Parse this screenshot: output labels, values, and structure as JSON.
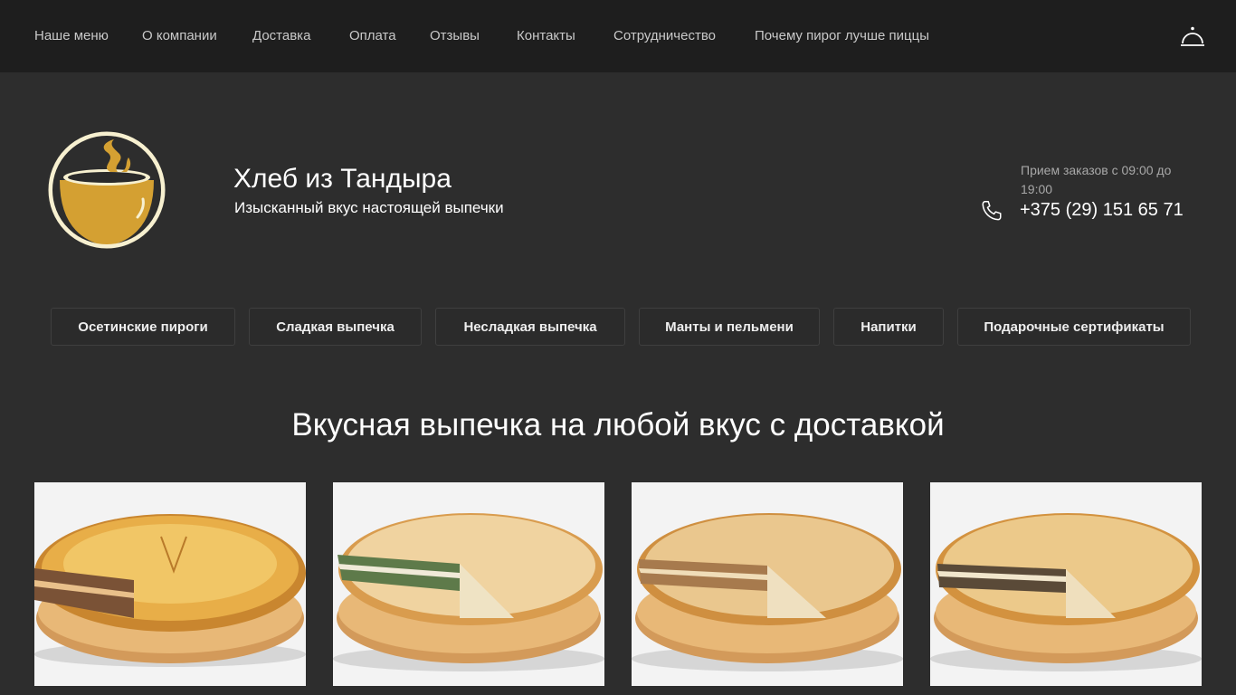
{
  "nav": {
    "items": [
      {
        "label": "Наше меню"
      },
      {
        "label": "О компании"
      },
      {
        "label": "Доставка"
      },
      {
        "label": "Оплата"
      },
      {
        "label": "Отзывы"
      },
      {
        "label": "Контакты"
      },
      {
        "label": "Сотрудничество"
      },
      {
        "label": "Почему пирог лучше пиццы"
      }
    ],
    "cart_icon": "cloche-icon"
  },
  "header": {
    "logo_icon": "pot-logo-icon",
    "title": "Хлеб из Тандыра",
    "subtitle": "Изысканный вкус настоящей выпечки",
    "hours": "Прием заказов с 09:00 до 19:00",
    "phone": "+375 (29) 151 65 71",
    "phone_icon": "phone-icon"
  },
  "categories": [
    {
      "label": "Осетинские пироги"
    },
    {
      "label": "Сладкая выпечка"
    },
    {
      "label": "Несладкая выпечка"
    },
    {
      "label": "Манты и пельмени"
    },
    {
      "label": "Напитки"
    },
    {
      "label": "Подарочные сертификаты"
    }
  ],
  "section": {
    "title": "Вкусная выпечка на любой вкус с доставкой"
  },
  "products": [
    {
      "image": "ossetian-pie-meat-photo"
    },
    {
      "image": "ossetian-pie-greens-photo"
    },
    {
      "image": "ossetian-pie-potato-photo"
    },
    {
      "image": "ossetian-pie-mushroom-photo"
    }
  ],
  "colors": {
    "topbar_bg": "#1e1e1e",
    "page_bg": "#2d2d2d",
    "logo_gold": "#d4a032",
    "logo_cream": "#f7f0d0"
  }
}
